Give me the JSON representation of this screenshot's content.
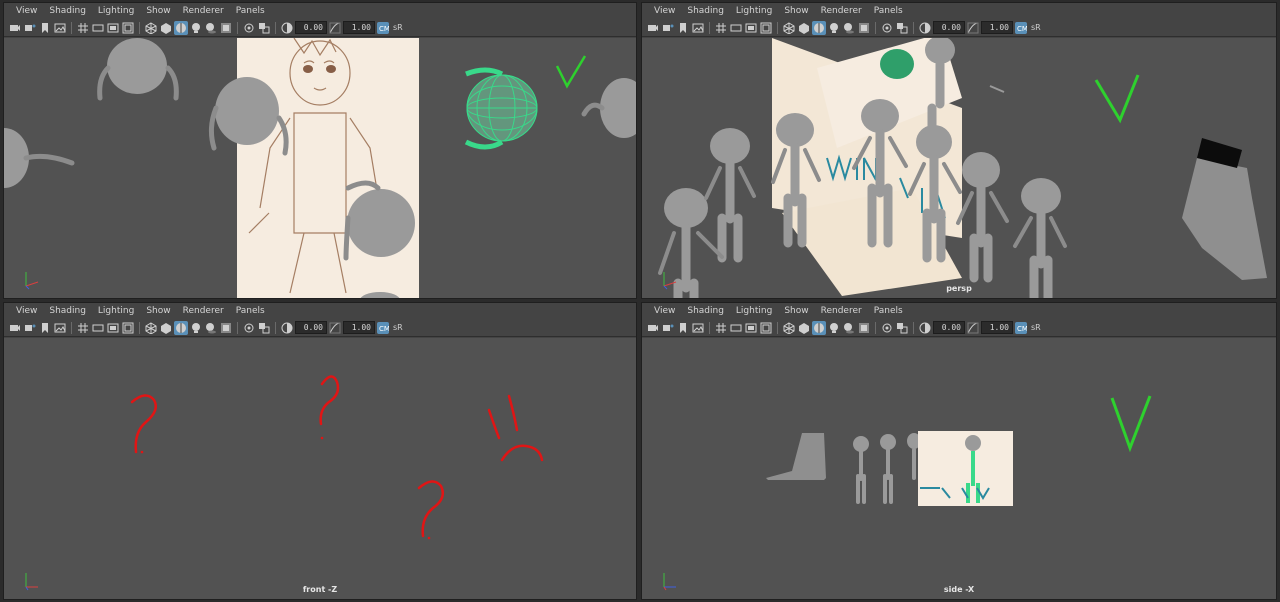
{
  "menus": [
    "View",
    "Shading",
    "Lighting",
    "Show",
    "Renderer",
    "Panels"
  ],
  "toolbar": {
    "exposure_value": "0.00",
    "gamma_value": "1.00",
    "colorspace_label": "sR"
  },
  "panels": {
    "top_left": {
      "camera_label": ""
    },
    "top_right": {
      "camera_label": "persp"
    },
    "bottom_left": {
      "camera_label": "front -Z"
    },
    "bottom_right": {
      "camera_label": "side -X"
    }
  },
  "colors": {
    "accent": "#5a90b8",
    "viewport_bg": "#525252",
    "selection_green": "#39d98a",
    "annotation_red": "#e01515",
    "annotation_green": "#2ed12e"
  },
  "icons": [
    "camera-select-icon",
    "camera-attributes-icon",
    "bookmark-icon",
    "image-plane-icon",
    "grid-icon",
    "film-gate-icon",
    "resolution-gate-icon",
    "safe-action-icon",
    "wireframe-icon",
    "smooth-shade-icon",
    "textured-icon",
    "lights-icon",
    "shadows-icon",
    "ambient-occlusion-icon",
    "isolate-select-icon",
    "xray-icon",
    "exposure-icon",
    "gamma-icon",
    "colorspace-icon"
  ]
}
